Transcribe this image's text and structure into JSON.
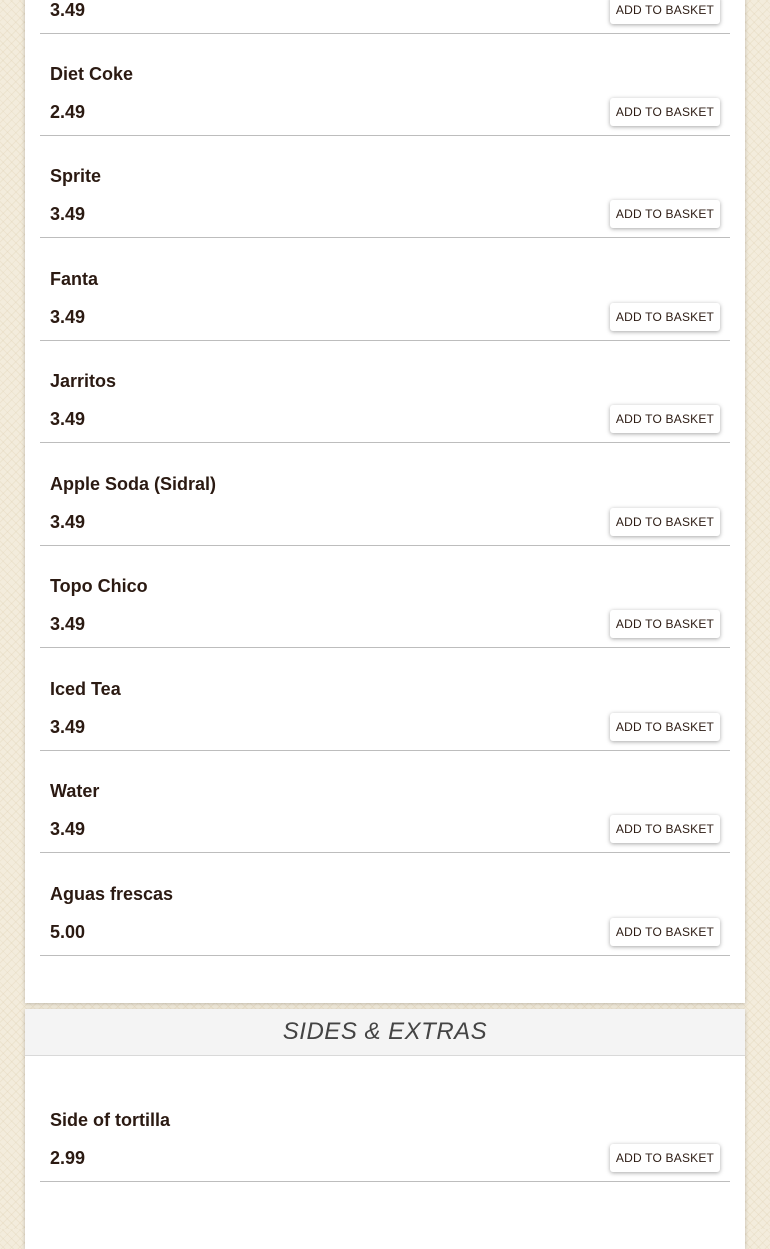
{
  "drinks": {
    "items": [
      {
        "name": "",
        "price": "3.49",
        "button": "ADD TO BASKET"
      },
      {
        "name": "Diet Coke",
        "price": "2.49",
        "button": "ADD TO BASKET"
      },
      {
        "name": "Sprite",
        "price": "3.49",
        "button": "ADD TO BASKET"
      },
      {
        "name": "Fanta",
        "price": "3.49",
        "button": "ADD TO BASKET"
      },
      {
        "name": "Jarritos",
        "price": "3.49",
        "button": "ADD TO BASKET"
      },
      {
        "name": "Apple Soda (Sidral)",
        "price": "3.49",
        "button": "ADD TO BASKET"
      },
      {
        "name": "Topo Chico",
        "price": "3.49",
        "button": "ADD TO BASKET"
      },
      {
        "name": "Iced Tea",
        "price": "3.49",
        "button": "ADD TO BASKET"
      },
      {
        "name": "Water",
        "price": "3.49",
        "button": "ADD TO BASKET"
      },
      {
        "name": "Aguas frescas",
        "price": "5.00",
        "button": "ADD TO BASKET"
      }
    ]
  },
  "sides": {
    "title": "SIDES & EXTRAS",
    "items": [
      {
        "name": "Side of tortilla",
        "price": "2.99",
        "button": "ADD TO BASKET"
      }
    ]
  },
  "colors": {
    "page_background": "#f3ecdc",
    "card_background": "#ffffff",
    "text": "#2b1a12",
    "section_header_background": "#f4f4f4"
  }
}
